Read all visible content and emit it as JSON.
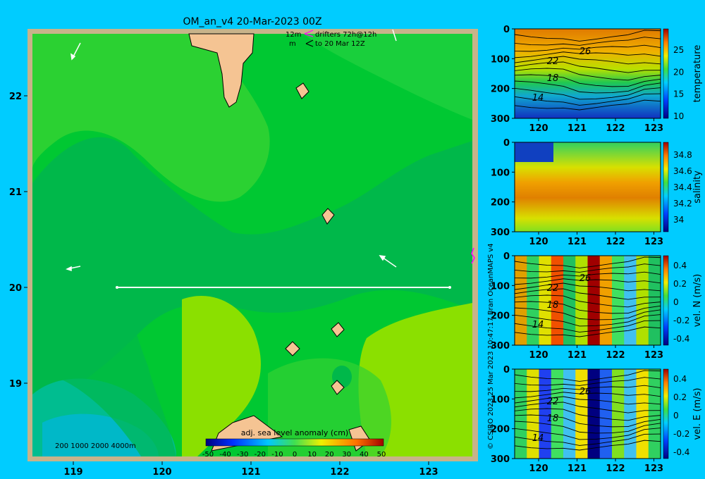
{
  "colors": {
    "background": "#00ccff",
    "land": "#f5c493",
    "frame": "#c8b38a",
    "ssh_low": "#00b7d6",
    "ssh_mid": "#00c832",
    "ssh_high": "#8be000",
    "drifter": "#ff00ff"
  },
  "map": {
    "title": "OM_an_v4  20-Mar-2023 00Z",
    "legend_lines": [
      "12m",
      "m",
      "drifters 72h@12h",
      "to 20 Mar 12Z"
    ],
    "isobath_labels": "200  1000  2000  4000m",
    "colorbar_title": "adj. sea level anomaly (cm)",
    "colorbar_ticks": [
      "-50",
      "-40",
      "-30",
      "-20",
      "-10",
      "0",
      "10",
      "20",
      "30",
      "40",
      "50"
    ],
    "lon_ticks": [
      "119",
      "120",
      "121",
      "122",
      "123"
    ],
    "lat_ticks": [
      "22",
      "21",
      "20",
      "19"
    ],
    "credit": "© CSIRO 2023   25 Mar 2023 10:47:17 Bran OceanMAPS v4",
    "section_line": {
      "lon_start": 119.5,
      "lon_end": 123.2,
      "lat": 20.0
    },
    "vectors": [
      {
        "lon": 118.9,
        "lat": 22.4,
        "dlon": 0.1,
        "dlat": 0.2
      },
      {
        "lon": 118.9,
        "lat": 20.2,
        "dlon": 0.1,
        "dlat": 0.02
      },
      {
        "lon": 122.4,
        "lat": 20.3,
        "dlon": -0.2,
        "dlat": 0.1
      },
      {
        "lon": 122.7,
        "lat": 22.6,
        "dlon": -0.02,
        "dlat": 0.1
      }
    ]
  },
  "panels": [
    {
      "label": "temperature",
      "y_ticks": [
        "0",
        "100",
        "200",
        "300"
      ],
      "x_ticks": [
        "120",
        "121",
        "122",
        "123"
      ],
      "cb_ticks": [
        "25",
        "20",
        "15",
        "10"
      ],
      "contour_labels": [
        "26",
        "22",
        "18",
        "14"
      ]
    },
    {
      "label": "salinity",
      "y_ticks": [
        "0",
        "100",
        "200",
        "300"
      ],
      "x_ticks": [
        "120",
        "121",
        "122",
        "123"
      ],
      "cb_ticks": [
        "34.8",
        "34.6",
        "34.4",
        "34.2",
        "34"
      ],
      "contour_labels": []
    },
    {
      "label": "vel. N (m/s)",
      "y_ticks": [
        "0",
        "100",
        "200",
        "300"
      ],
      "x_ticks": [
        "120",
        "121",
        "122",
        "123"
      ],
      "cb_ticks": [
        "0.4",
        "0.2",
        "0",
        "-0.2",
        "-0.4"
      ],
      "contour_labels": [
        "26",
        "22",
        "18",
        "14"
      ]
    },
    {
      "label": "vel. E (m/s)",
      "y_ticks": [
        "0",
        "100",
        "200",
        "300"
      ],
      "x_ticks": [
        "120",
        "121",
        "122",
        "123"
      ],
      "cb_ticks": [
        "0.4",
        "0.2",
        "0",
        "-0.2",
        "-0.4"
      ],
      "contour_labels": [
        "26",
        "22",
        "18",
        "14"
      ]
    }
  ]
}
